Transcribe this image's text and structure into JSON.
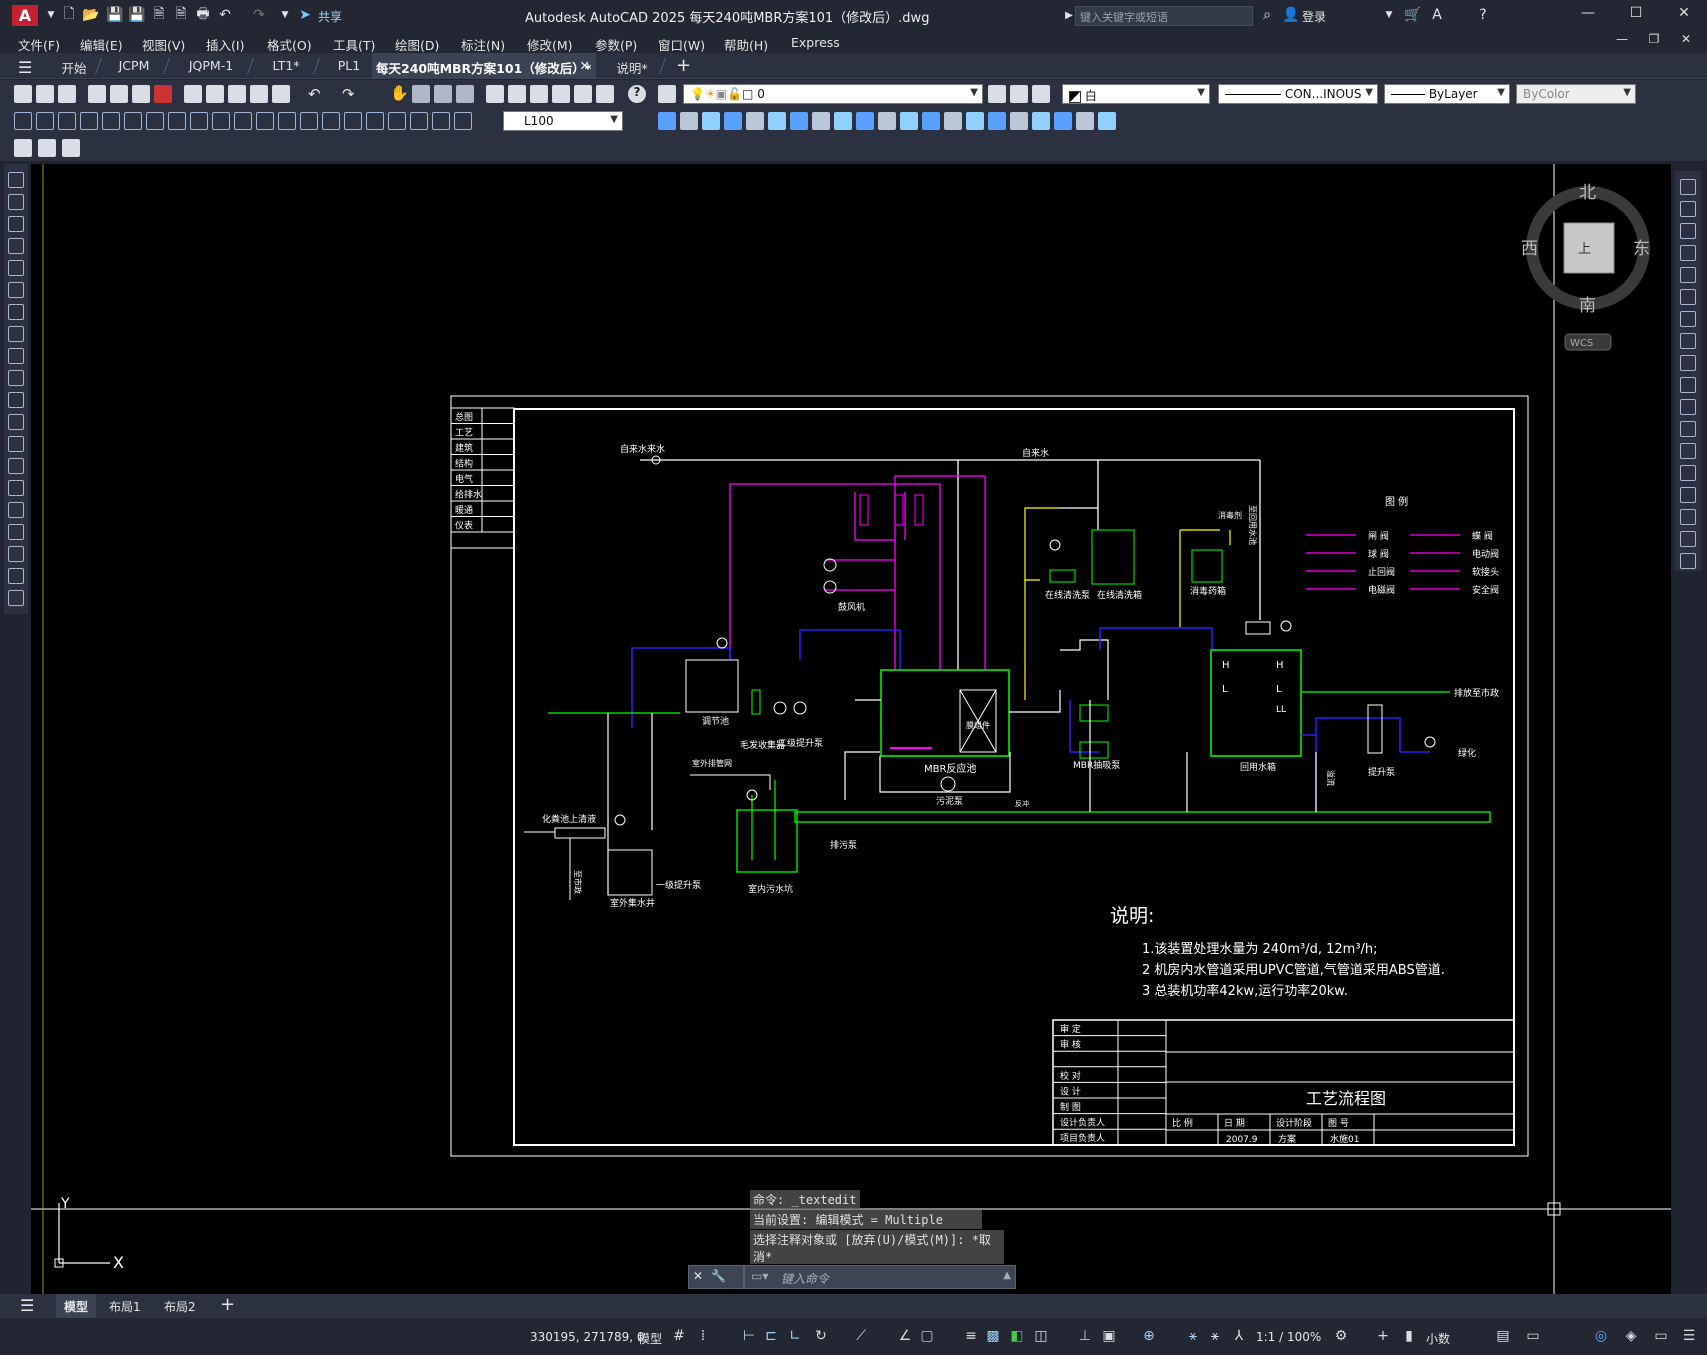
{
  "app": {
    "logo_letter": "A",
    "title": "Autodesk AutoCAD 2025    每天240吨MBR方案101（修改后）.dwg",
    "share_label": "共享",
    "search_placeholder": "键入关键字或短语",
    "login_label": "登录"
  },
  "menu": [
    "文件(F)",
    "编辑(E)",
    "视图(V)",
    "插入(I)",
    "格式(O)",
    "工具(T)",
    "绘图(D)",
    "标注(N)",
    "修改(M)",
    "参数(P)",
    "窗口(W)",
    "帮助(H)",
    "Express"
  ],
  "doc_tabs": [
    {
      "label": "开始",
      "active": false
    },
    {
      "label": "JCPM",
      "active": false
    },
    {
      "label": "JQPM-1",
      "active": false
    },
    {
      "label": "LT1*",
      "active": false
    },
    {
      "label": "PL1",
      "active": false
    },
    {
      "label": "每天240吨MBR方案101（修改后）*",
      "active": true
    },
    {
      "label": "说明*",
      "active": false
    }
  ],
  "properties": {
    "layer": "0",
    "color": "白",
    "linetype": "CON...INOUS",
    "lineweight": "ByLayer",
    "plotstyle": "ByColor",
    "dimstyle": "L100"
  },
  "viewcube": {
    "north": "北",
    "south": "南",
    "east": "东",
    "west": "西",
    "top_label": "上",
    "wcs": "WCS"
  },
  "ucs": {
    "x": "X",
    "y": "Y"
  },
  "command": {
    "history": [
      "命令: _textedit",
      "当前设置: 编辑模式 = Multiple",
      "选择注释对象或 [放弃(U)/模式(M)]: *取消*"
    ],
    "placeholder": "键入命令"
  },
  "layout_tabs": [
    "模型",
    "布局1",
    "布局2"
  ],
  "status": {
    "coords": "330195, 271789, 0",
    "model": "模型",
    "scale": "1:1 / 100%",
    "units": "小数"
  },
  "drawing": {
    "left_index": [
      "总图",
      "工艺",
      "建筑",
      "结构",
      "电气",
      "给排水",
      "暖通",
      "仪表"
    ],
    "labels": {
      "tap_water_in": "自来水来水",
      "tap_water": "自来水",
      "fan": "鼓风机",
      "online_pump": "在线清洗泵",
      "online_tank": "在线清洗箱",
      "disinfect_tank": "消毒药箱",
      "disinfectant": "消毒剂",
      "to_reclaim": "至回用水池",
      "regulating": "调节池",
      "hair_catcher": "毛发收集器",
      "lift_pump2": "二级提升泵",
      "mbr_tank": "MBR反应池",
      "membrane": "膜组件",
      "mbr_pump": "MBR抽吸泵",
      "reclaim_tank": "回用水箱",
      "sludge_pump": "污泥泵",
      "outdoor_drain": "室外排管网",
      "septic": "化粪池上清液",
      "to_sewer": "至市政",
      "outdoor_well": "室外集水井",
      "lift_pump1": "一级提升泵",
      "indoor_pit": "室内污水坑",
      "drain_pump": "排污泵",
      "lift_pump_r": "提升泵",
      "discharge": "排放至市政",
      "greening": "绿化",
      "overflow": "溢流",
      "backwash": "反冲",
      "h1": "H",
      "h2": "H",
      "l1": "L",
      "l2": "L",
      "ll": "LL"
    },
    "legend": {
      "title": "图 例",
      "items": [
        "闸 阀",
        "球 阀",
        "止回阀",
        "电磁阀",
        "蝶 阀",
        "电动阀",
        "软接头",
        "安全阀"
      ]
    },
    "notes": {
      "heading": "说明:",
      "lines": [
        "1.该装置处理水量为  240m³/d,     12m³/h;",
        "2  机房内水管道采用UPVC管道,气管道采用ABS管道.",
        "3  总装机功率42kw,运行功率20kw."
      ]
    },
    "title_block": {
      "rows": [
        "审  定",
        "审  核",
        "",
        "校  对",
        "设  计",
        "制  图",
        "设计负责人",
        "项目负责人"
      ],
      "drawing_title": "工艺流程图",
      "headers": [
        "比  例",
        "日  期",
        "设计阶段",
        "图  号"
      ],
      "values": [
        "",
        "2007.9",
        "方案",
        "水施01"
      ]
    }
  },
  "colors": {
    "canvas": "#000000",
    "green": "#00ff00",
    "blue": "#1a1aff",
    "magenta": "#ff00ff",
    "yellow": "#ffff00",
    "white": "#ffffff",
    "cyan": "#00ffff"
  }
}
